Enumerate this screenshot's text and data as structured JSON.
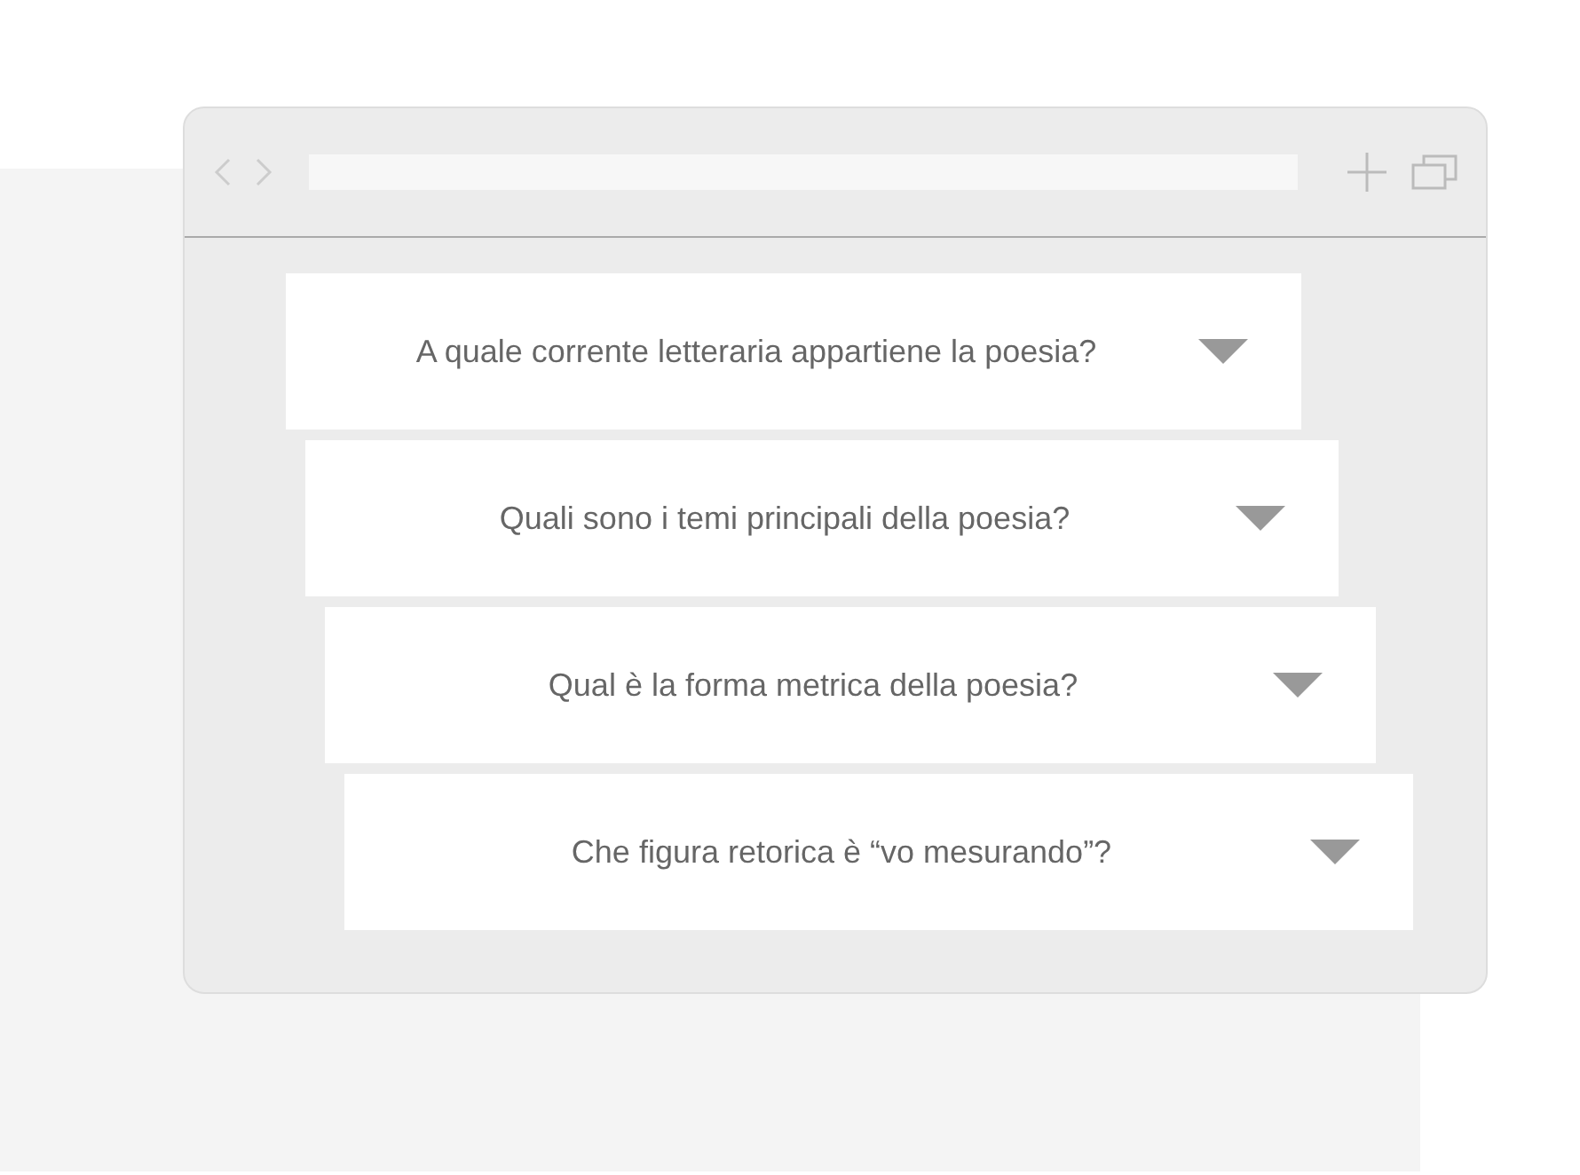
{
  "questions": [
    {
      "text": "A quale corrente letteraria appartiene la poesia?",
      "expanded": false
    },
    {
      "text": "Quali sono i temi principali della poesia?",
      "expanded": false
    },
    {
      "text": "Qual è la forma metrica della poesia?",
      "expanded": false
    },
    {
      "text": "Che figura retorica è “vo mesurando”?",
      "expanded": false
    }
  ]
}
